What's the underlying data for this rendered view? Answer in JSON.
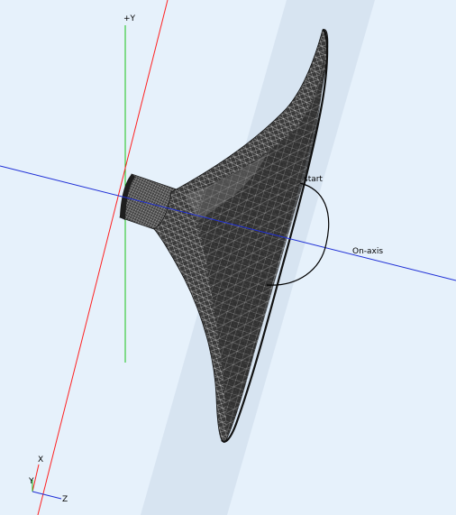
{
  "viewport": {
    "background": "#e6f1fb",
    "plane_color": "#d6e3f0"
  },
  "axes": {
    "y_label": "+Y",
    "y_color": "#19c219",
    "x_color": "#ff2020",
    "z_color": "#1f2fd6"
  },
  "annotations": {
    "on_axis_label": "On-axis",
    "arc_label": "start"
  },
  "model": {
    "name": "horn-mesh",
    "fill": "#3b3b3b",
    "wire": "#d9d9d9"
  },
  "orientation_triad": {
    "x_label": "X",
    "y_label": "Y",
    "z_label": "Z"
  }
}
